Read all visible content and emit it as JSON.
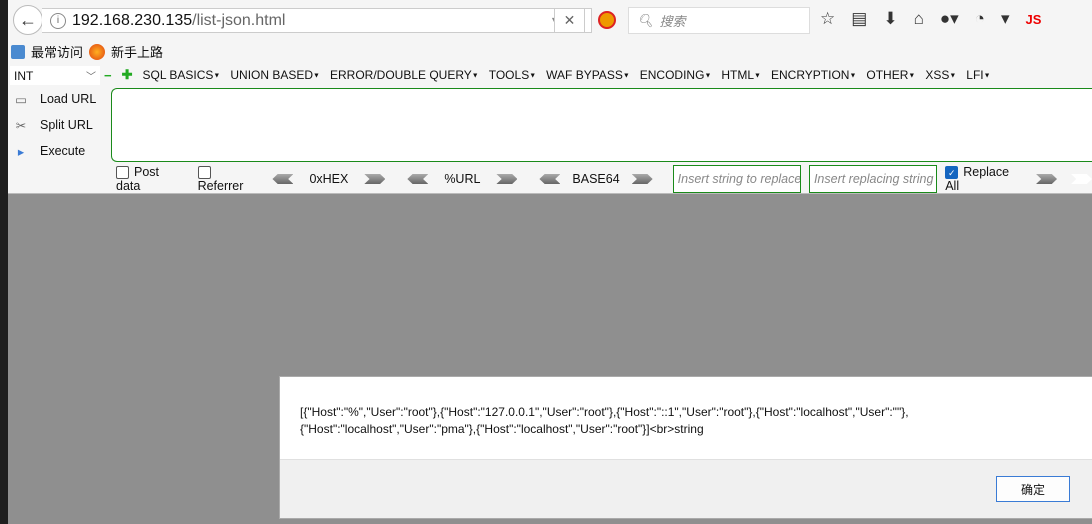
{
  "browser": {
    "url_host": "192.168.230.135",
    "url_path": "/list-json.html",
    "search_placeholder": "搜索",
    "js_label": "JS"
  },
  "bookmarks": [
    {
      "label": "最常访问"
    },
    {
      "label": "新手上路"
    }
  ],
  "hackbar": {
    "type_select": "INT",
    "menus": [
      "SQL BASICS",
      "UNION BASED",
      "ERROR/DOUBLE QUERY",
      "TOOLS",
      "WAF BYPASS",
      "ENCODING",
      "HTML",
      "ENCRYPTION",
      "OTHER",
      "XSS",
      "LFI"
    ],
    "actions": {
      "load": "Load URL",
      "split": "Split URL",
      "execute": "Execute"
    },
    "url_value": "",
    "post_data": "Post data",
    "referrer": "Referrer",
    "hex": "0xHEX",
    "url_enc": "%URL",
    "base64": "BASE64",
    "replace_placeholder": "Insert string to replace",
    "replacing_placeholder": "Insert replacing string",
    "replace_all": "Replace All",
    "replace_all_checked": true
  },
  "dialog": {
    "message": "[{\"Host\":\"%\",\"User\":\"root\"},{\"Host\":\"127.0.0.1\",\"User\":\"root\"},{\"Host\":\"::1\",\"User\":\"root\"},{\"Host\":\"localhost\",\"User\":\"\"},\n{\"Host\":\"localhost\",\"User\":\"pma\"},{\"Host\":\"localhost\",\"User\":\"root\"}]<br>string",
    "ok": "确定"
  }
}
